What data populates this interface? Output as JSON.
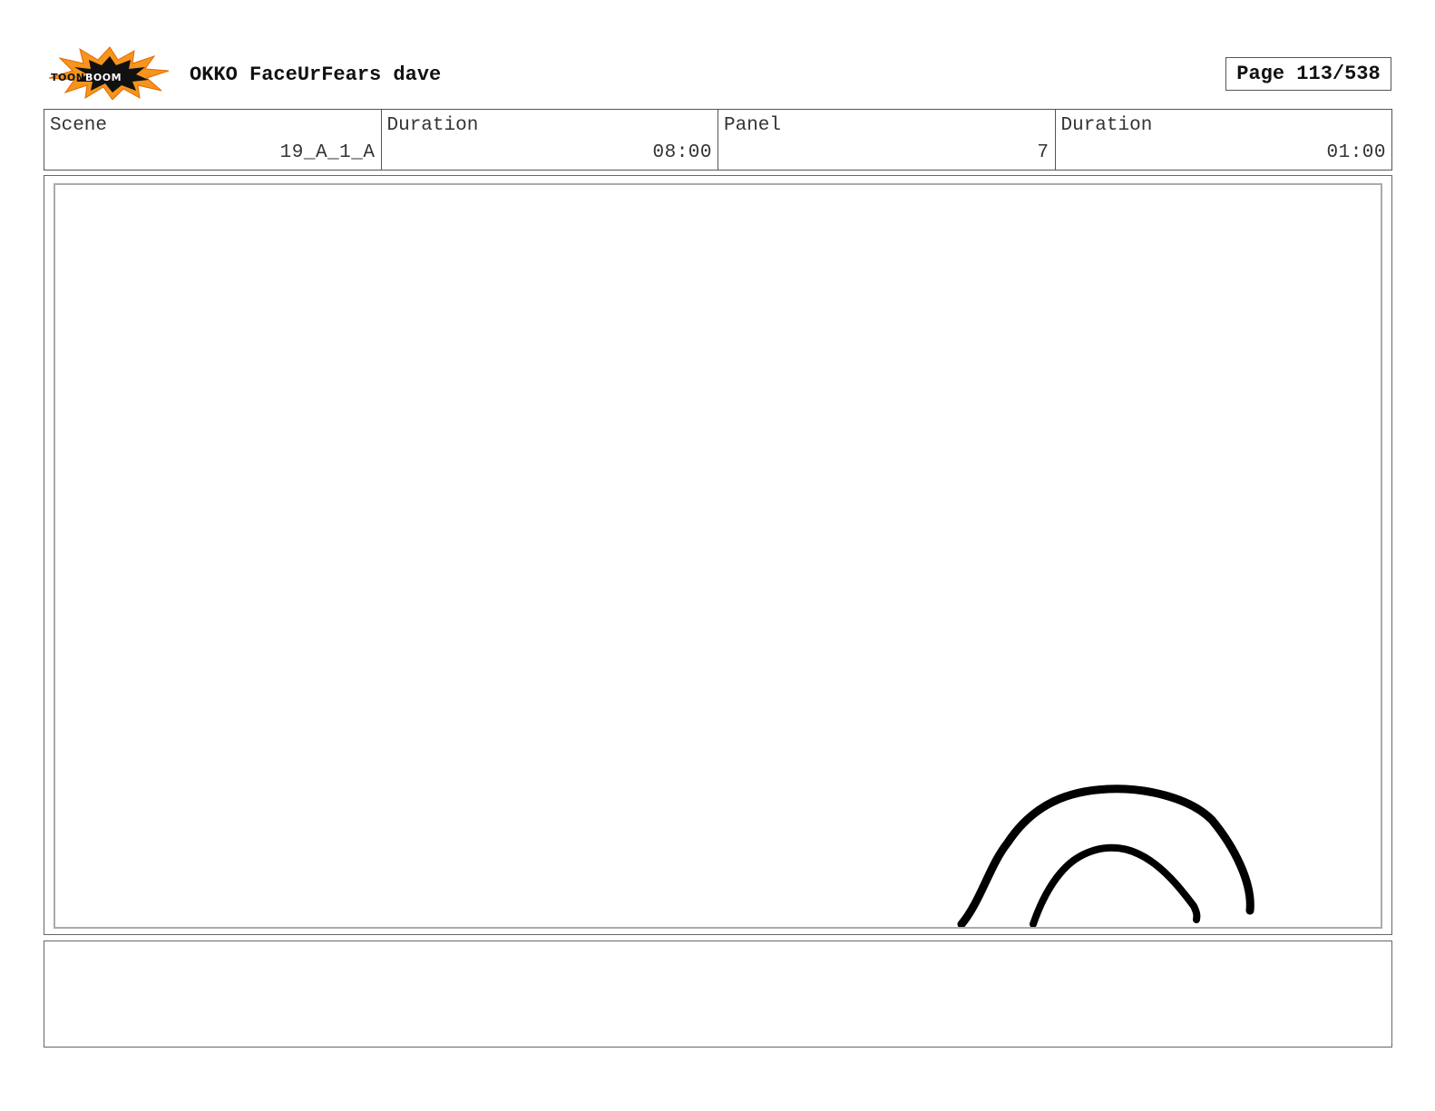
{
  "header": {
    "logo": {
      "name": "toon-boom-logo",
      "text": "TOON BOOM",
      "colors": {
        "burst_outer": "#f7941d",
        "burst_inner": "#111111",
        "text": "#ffffff"
      }
    },
    "title": "OKKO FaceUrFears dave",
    "page_label": "Page 113/538"
  },
  "info": {
    "scene_label": "Scene",
    "scene_value": "19_A_1_A",
    "scene_duration_label": "Duration",
    "scene_duration_value": "08:00",
    "panel_label": "Panel",
    "panel_value": "7",
    "panel_duration_label": "Duration",
    "panel_duration_value": "01:00"
  },
  "panel": {
    "drawing": "two concentric black arcs rising from the bottom edge",
    "stroke_color": "#000000"
  },
  "notes": {
    "text": ""
  }
}
